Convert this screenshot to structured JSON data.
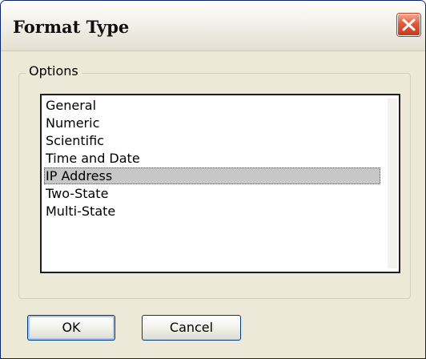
{
  "dialog": {
    "title": "Format Type"
  },
  "options": {
    "legend": "Options",
    "items": [
      "General",
      "Numeric",
      "Scientific",
      "Time and Date",
      "IP Address",
      "Two-State",
      "Multi-State"
    ],
    "selected": "IP Address"
  },
  "buttons": {
    "ok": "OK",
    "cancel": "Cancel"
  },
  "icons": {
    "close": "close-icon"
  }
}
